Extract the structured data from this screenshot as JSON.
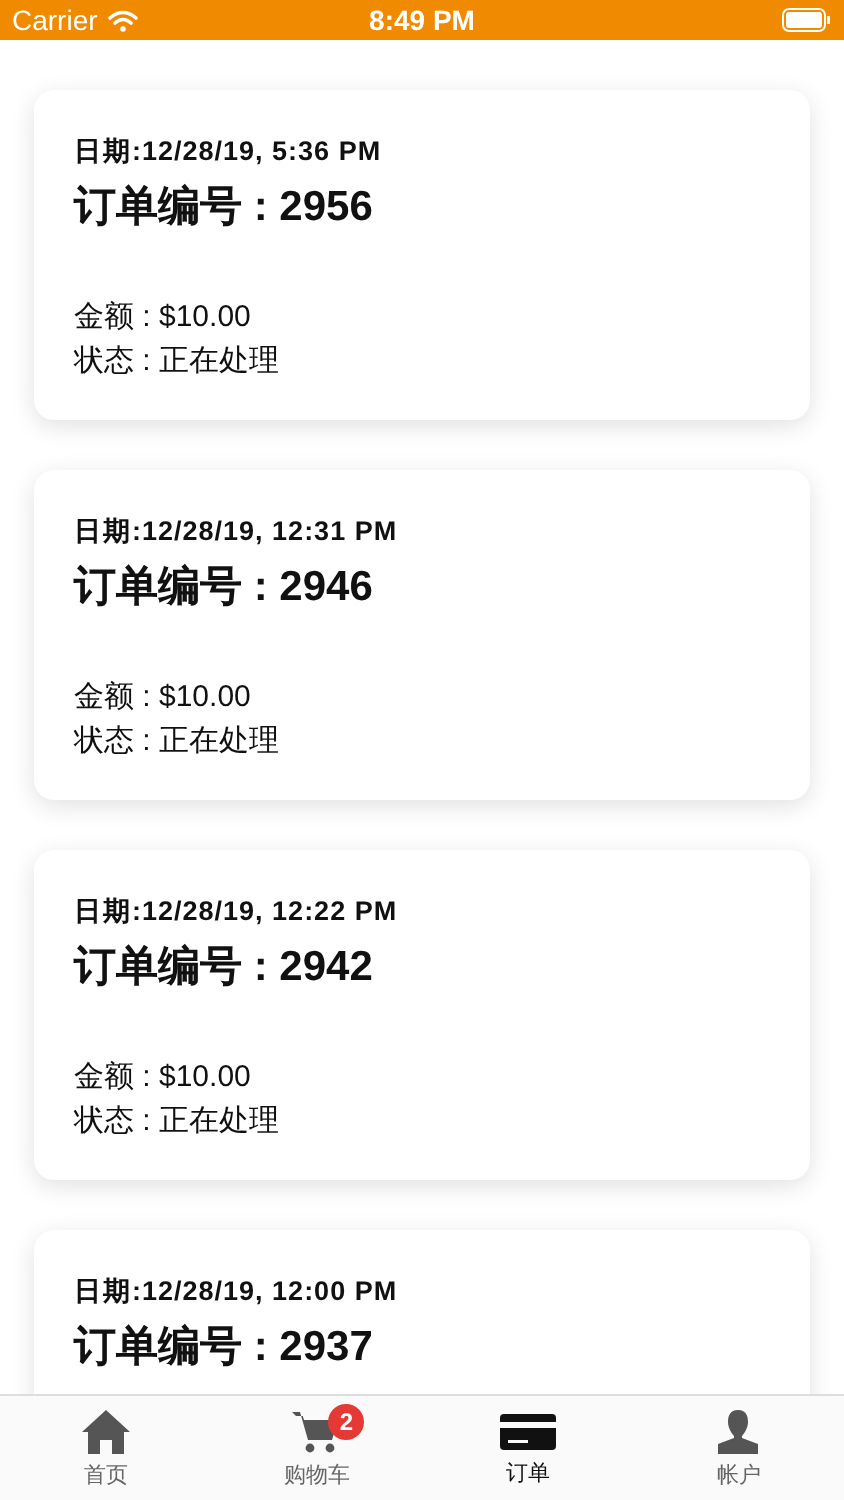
{
  "status_bar": {
    "carrier": "Carrier",
    "time": "8:49 PM"
  },
  "orders": [
    {
      "date": "日期:12/28/19, 5:36 PM",
      "title": "订单编号 : 2956",
      "amount": "金额 : $10.00",
      "status": "状态 : 正在处理"
    },
    {
      "date": "日期:12/28/19, 12:31 PM",
      "title": "订单编号 : 2946",
      "amount": "金额 : $10.00",
      "status": "状态 : 正在处理"
    },
    {
      "date": "日期:12/28/19, 12:22 PM",
      "title": "订单编号 : 2942",
      "amount": "金额 : $10.00",
      "status": "状态 : 正在处理"
    },
    {
      "date": "日期:12/28/19, 12:00 PM",
      "title": "订单编号 : 2937"
    }
  ],
  "tab_bar": [
    {
      "label": "首页",
      "selected": false
    },
    {
      "label": "购物车",
      "selected": false,
      "badge": "2"
    },
    {
      "label": "订单",
      "selected": true
    },
    {
      "label": "帐户",
      "selected": false
    }
  ]
}
